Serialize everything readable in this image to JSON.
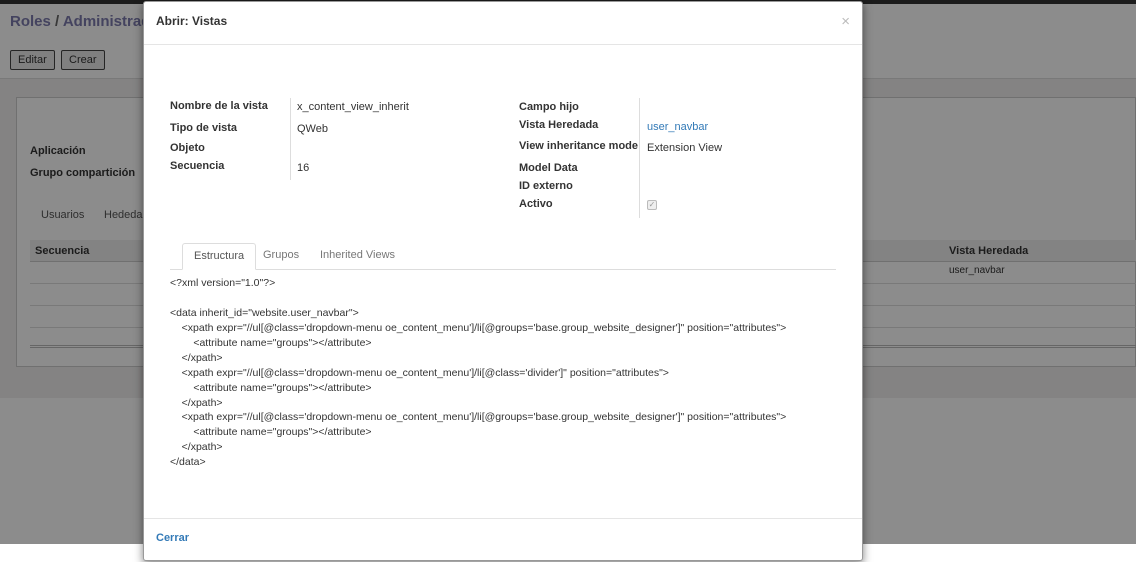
{
  "background": {
    "breadcrumb_root": "Roles",
    "breadcrumb_sep": "/",
    "breadcrumb_current": "Administrad",
    "edit_label": "Editar",
    "create_label": "Crear",
    "field_application": "Aplicación",
    "field_share_group": "Grupo compartición",
    "tab_users": "Usuarios",
    "tab_inherited": "Hededa",
    "col_sequence": "Secuencia",
    "col_inherited_view": "Vista Heredada",
    "row_value": "user_navbar"
  },
  "modal": {
    "title": "Abrir: Vistas",
    "close_glyph": "×",
    "left_fields": [
      {
        "label": "Nombre de la vista",
        "value": "x_content_view_inherit"
      },
      {
        "label": "Tipo de vista",
        "value": "QWeb"
      },
      {
        "label": "Objeto",
        "value": ""
      },
      {
        "label": "Secuencia",
        "value": "16"
      }
    ],
    "right_fields": {
      "child_field_label": "Campo hijo",
      "inherited_view_label": "Vista Heredada",
      "inherited_view_value": "user_navbar",
      "inheritance_mode_label": "View inheritance mode",
      "inheritance_mode_value": "Extension View",
      "model_data_label": "Model Data",
      "external_id_label": "ID externo",
      "active_label": "Activo",
      "active_checked": true
    },
    "tabs": [
      "Estructura",
      "Grupos",
      "Inherited Views"
    ],
    "active_tab": "Estructura",
    "code_lines": [
      "<?xml version=\"1.0\"?>",
      "",
      "<data inherit_id=\"website.user_navbar\">",
      "    <xpath expr=\"//ul[@class='dropdown-menu oe_content_menu']/li[@groups='base.group_website_designer']\" position=\"attributes\">",
      "        <attribute name=\"groups\"></attribute>",
      "    </xpath>",
      "    <xpath expr=\"//ul[@class='dropdown-menu oe_content_menu']/li[@class='divider']\" position=\"attributes\">",
      "        <attribute name=\"groups\"></attribute>",
      "    </xpath>",
      "    <xpath expr=\"//ul[@class='dropdown-menu oe_content_menu']/li[@groups='base.group_website_designer']\" position=\"attributes\">",
      "        <attribute name=\"groups\"></attribute>",
      "    </xpath>",
      "</data>"
    ],
    "footer_close": "Cerrar"
  },
  "colors": {
    "link": "#337ab7",
    "title_purple": "#7c7bad",
    "overlay": "rgba(0,0,0,0.45)"
  },
  "icons": {
    "close": "close-icon",
    "checkbox": "checkbox-checked-icon"
  }
}
